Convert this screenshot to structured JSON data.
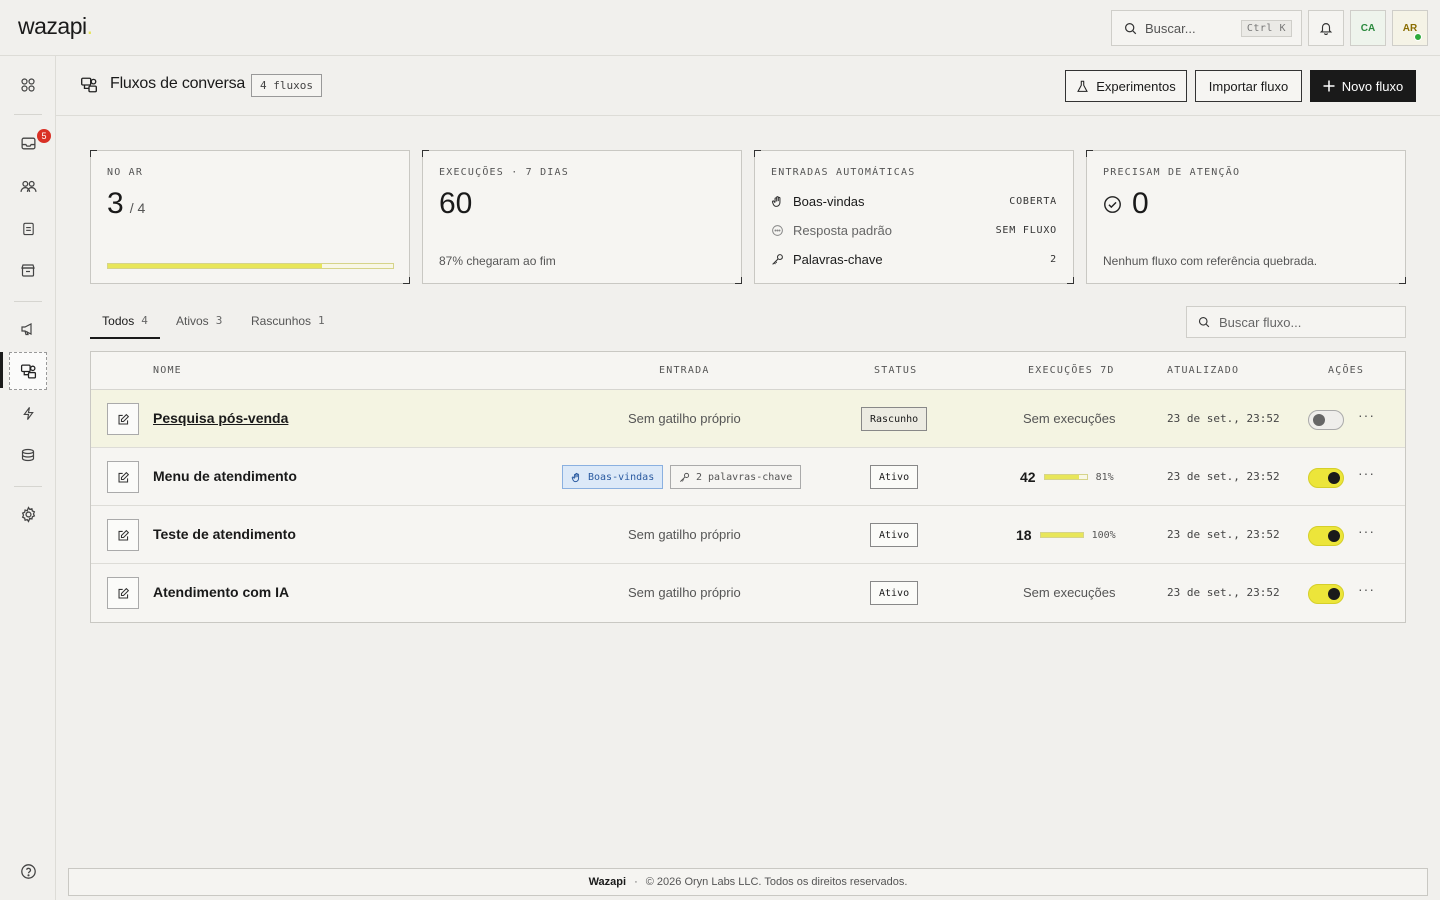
{
  "app": {
    "logo": "wazapi",
    "search": {
      "placeholder": "Buscar...",
      "shortcut": "Ctrl K"
    },
    "user_chips": [
      "CA",
      "AR"
    ],
    "accent_color": "#e8e65a"
  },
  "sidebar": {
    "inbox_badge": "5",
    "items": [
      "grid-icon",
      "inbox-icon",
      "users-icon",
      "clipboard-icon",
      "store-icon",
      "megaphone-icon",
      "flows-icon",
      "bolt-icon",
      "stack-icon",
      "gear-icon",
      "help-icon"
    ]
  },
  "header": {
    "title": "Fluxos de conversa",
    "count": "4 fluxos",
    "buttons": {
      "experiments": "Experimentos",
      "import": "Importar fluxo",
      "new": "Novo fluxo"
    }
  },
  "stats": {
    "on_air": {
      "label": "NO AR",
      "value": "3",
      "total": "4",
      "fraction": 0.75
    },
    "executions": {
      "label": "EXECUÇÕES · 7 DIAS",
      "value": "60",
      "sub": "87% chegaram ao fim"
    },
    "auto_entries": {
      "label": "ENTRADAS AUTOMÁTICAS",
      "rows": [
        {
          "label": "Boas-vindas",
          "value": "COBERTA"
        },
        {
          "label": "Resposta padrão",
          "value": "SEM FLUXO"
        },
        {
          "label": "Palavras-chave",
          "value": "2"
        }
      ]
    },
    "attention": {
      "label": "PRECISAM DE ATENÇÃO",
      "value": "0",
      "sub": "Nenhum fluxo com referência quebrada."
    }
  },
  "tabs": [
    {
      "label": "Todos",
      "count": "4"
    },
    {
      "label": "Ativos",
      "count": "3"
    },
    {
      "label": "Rascunhos",
      "count": "1"
    }
  ],
  "flow_search": {
    "placeholder": "Buscar fluxo..."
  },
  "table": {
    "headers": {
      "name": "NOME",
      "entry": "ENTRADA",
      "status": "STATUS",
      "exec": "EXECUÇÕES 7D",
      "updated": "ATUALIZADO",
      "actions": "AÇÕES"
    },
    "rows": [
      {
        "name": "Pesquisa pós-venda",
        "entry": "Sem gatilho próprio",
        "status": "Rascunho",
        "exec": "Sem execuções",
        "updated": "23 de set., 23:52",
        "enabled": false
      },
      {
        "name": "Menu de atendimento",
        "entry_chip": "Boas-vindas",
        "entry_keywords": "2 palavras-chave",
        "status": "Ativo",
        "exec_count": "42",
        "exec_pct": "81%",
        "exec_fraction": 0.81,
        "updated": "23 de set., 23:52",
        "enabled": true
      },
      {
        "name": "Teste de atendimento",
        "entry": "Sem gatilho próprio",
        "status": "Ativo",
        "exec_count": "18",
        "exec_pct": "100%",
        "exec_fraction": 1.0,
        "updated": "23 de set., 23:52",
        "enabled": true
      },
      {
        "name": "Atendimento com IA",
        "entry": "Sem gatilho próprio",
        "status": "Ativo",
        "exec": "Sem execuções",
        "updated": "23 de set., 23:52",
        "enabled": true
      }
    ]
  },
  "footer": {
    "brand": "Wazapi",
    "sep": "·",
    "copyright": "© 2026 Oryn Labs LLC. Todos os direitos reservados."
  }
}
